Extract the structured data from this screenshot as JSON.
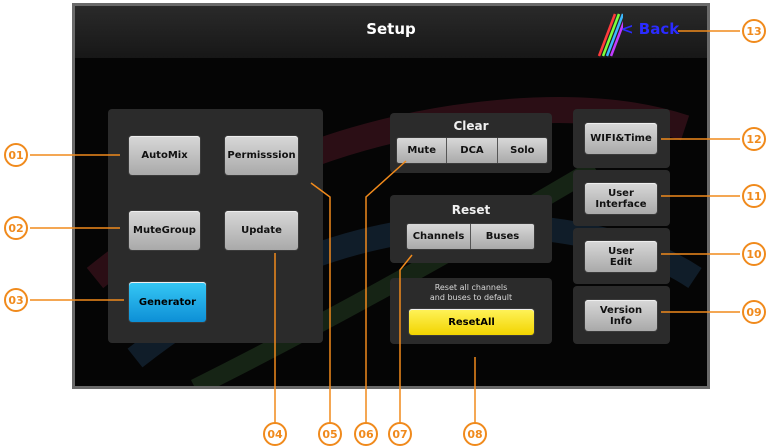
{
  "header": {
    "title": "Setup",
    "back_label": "< Back"
  },
  "left_panel": {
    "automix": "AutoMix",
    "permission": "Permisssion",
    "mutegroup": "MuteGroup",
    "update": "Update",
    "generator": "Generator"
  },
  "clear": {
    "title": "Clear",
    "mute": "Mute",
    "dca": "DCA",
    "solo": "Solo"
  },
  "reset": {
    "title": "Reset",
    "channels": "Channels",
    "buses": "Buses"
  },
  "reset_all": {
    "note_line1": "Reset all channels",
    "note_line2": "and buses to default",
    "button": "ResetAll"
  },
  "right_panel": {
    "wifi": "WIFI&Time",
    "user_interface_1": "User",
    "user_interface_2": "Interface",
    "user_edit_1": "User",
    "user_edit_2": "Edit",
    "version_1": "Version",
    "version_2": "Info"
  },
  "callouts": [
    "01",
    "02",
    "03",
    "04",
    "05",
    "06",
    "07",
    "08",
    "09",
    "10",
    "11",
    "12",
    "13"
  ],
  "colors": {
    "accent": "#f08a1c",
    "generator": "#1aa9e8",
    "reset_all": "#f5e012",
    "back": "#2b2bff"
  }
}
